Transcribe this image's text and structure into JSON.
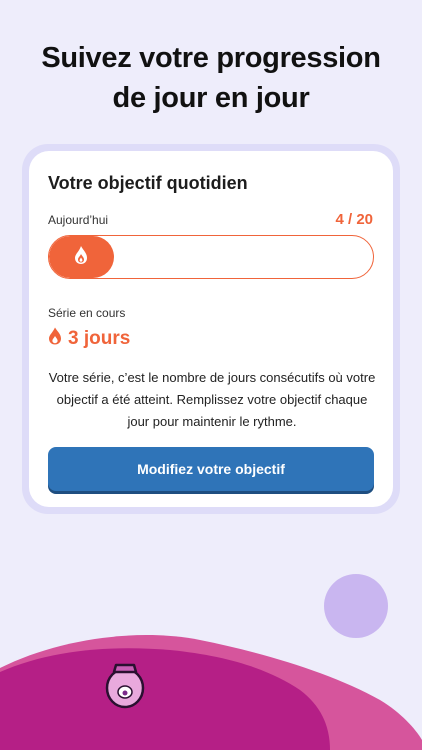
{
  "header": {
    "line1": "Suivez votre progression",
    "line2": "de jour en jour"
  },
  "card": {
    "title": "Votre objectif quotidien",
    "today_label": "Aujourd’hui",
    "today_count": "4 / 20",
    "progress_fraction": 0.2,
    "progress_icon": "flame-icon",
    "streak_label": "Série en cours",
    "streak_icon": "flame-icon",
    "streak_value": "3 jours",
    "description": "Votre série, c’est le nombre de jours consécutifs où votre objectif a été atteint. Remplissez votre objectif chaque jour pour maintenir le rythme.",
    "button_label": "Modifiez votre objectif"
  },
  "colors": {
    "accent": "#f0643a",
    "button": "#2f74b8",
    "background": "#eeedfb",
    "wave_dark": "#b51f86",
    "wave_light": "#d6559c",
    "circle": "#c9b6f0"
  }
}
